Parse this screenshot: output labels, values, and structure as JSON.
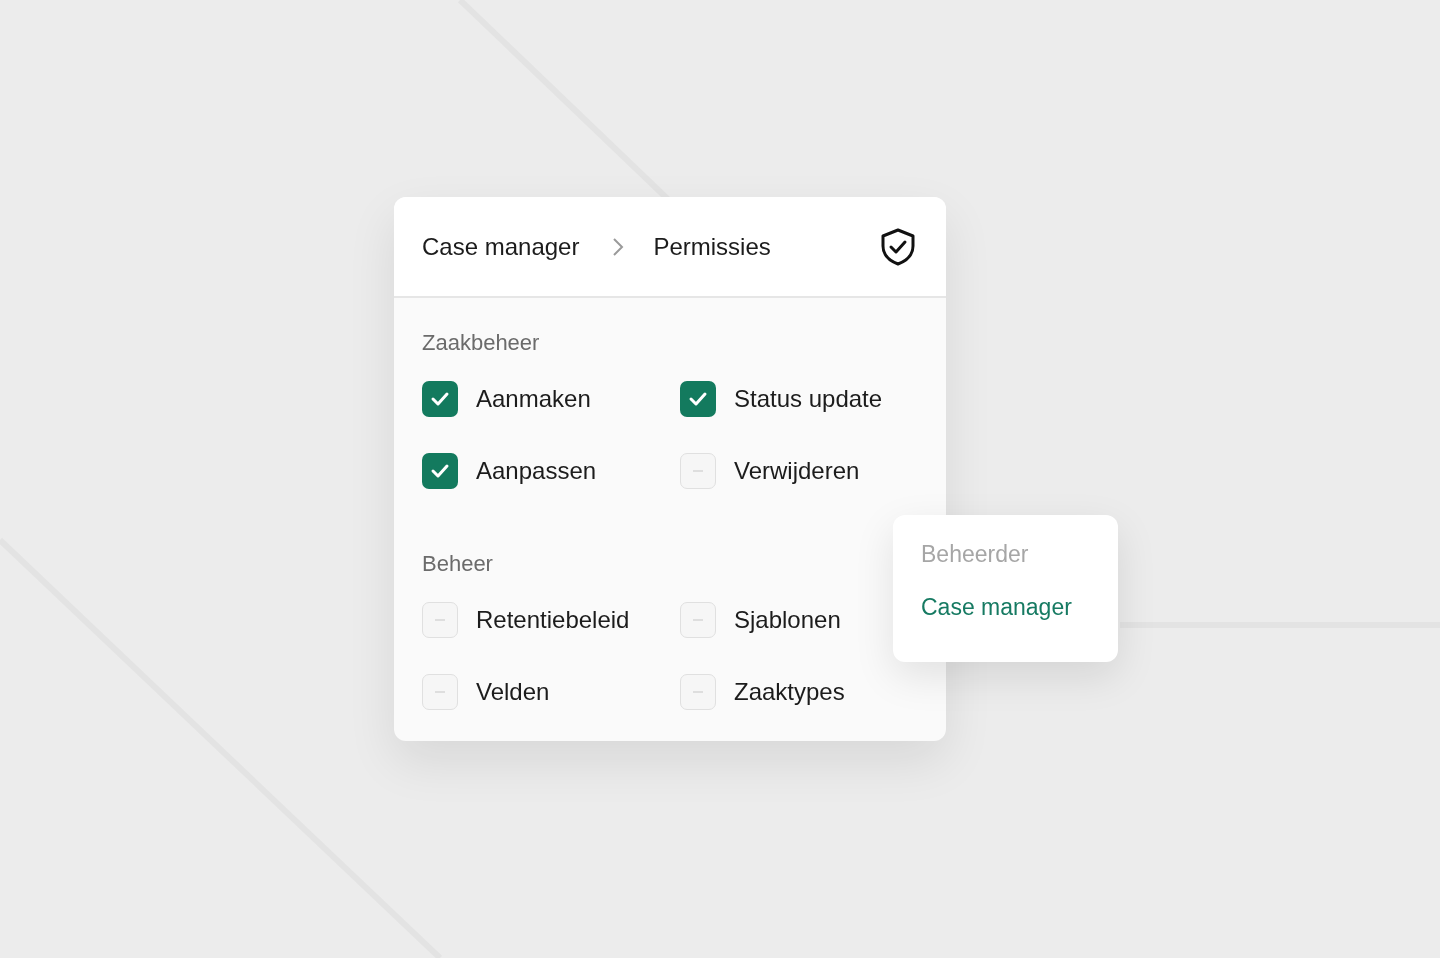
{
  "breadcrumb": [
    "Case manager",
    "Permissies"
  ],
  "sections": [
    {
      "title": "Zaakbeheer",
      "permissions": [
        {
          "label": "Aanmaken",
          "checked": true
        },
        {
          "label": "Status update",
          "checked": true
        },
        {
          "label": "Aanpassen",
          "checked": true
        },
        {
          "label": "Verwijderen",
          "checked": false
        }
      ]
    },
    {
      "title": "Beheer",
      "permissions": [
        {
          "label": "Retentiebeleid",
          "checked": false
        },
        {
          "label": "Sjablonen",
          "checked": false
        },
        {
          "label": "Velden",
          "checked": false
        },
        {
          "label": "Zaaktypes",
          "checked": false
        }
      ]
    }
  ],
  "roles": [
    {
      "label": "Beheerder",
      "selected": false
    },
    {
      "label": "Case manager",
      "selected": true
    }
  ]
}
